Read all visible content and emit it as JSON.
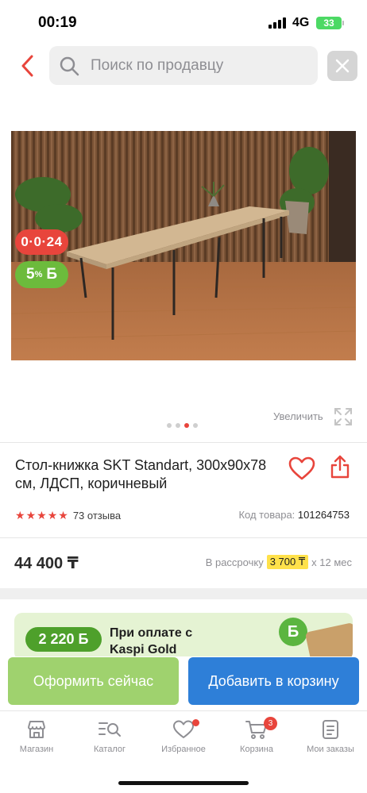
{
  "status_bar": {
    "time": "00:19",
    "network": "4G",
    "battery": "33"
  },
  "search": {
    "placeholder": "Поиск по продавцу"
  },
  "product": {
    "badge_installment": "0·0·24",
    "badge_bonus_percent": "5",
    "badge_bonus_symbol": "%",
    "badge_bonus_currency": "Б",
    "image_dots_total": 4,
    "image_dots_active_index": 2,
    "zoom_label": "Увеличить",
    "title": "Стол-книжка SKT Standart, 300x90x78 см, ЛДСП, коричневый",
    "rating": 5,
    "reviews": "73 отзыва",
    "sku_label": "Код товара:",
    "sku_value": "101264753",
    "price": "44 400 ₸",
    "installment_prefix": "В рассрочку",
    "installment_monthly": "3 700 ₸",
    "installment_suffix": "x 12 мес"
  },
  "promo": {
    "amount": "2 220 Б",
    "text_line1": "При оплате с",
    "text_line2": "Kaspi Gold",
    "logo_letter": "Б"
  },
  "actions": {
    "buy_now": "Оформить сейчас",
    "add_to_cart": "Добавить в корзину"
  },
  "tabs": [
    {
      "label": "Магазин",
      "icon": "shop-icon"
    },
    {
      "label": "Каталог",
      "icon": "catalog-search-icon"
    },
    {
      "label": "Избранное",
      "icon": "heart-icon",
      "dot": true
    },
    {
      "label": "Корзина",
      "icon": "cart-icon",
      "count": "3"
    },
    {
      "label": "Мои заказы",
      "icon": "orders-icon"
    }
  ],
  "colors": {
    "accent_red": "#e8453c",
    "bonus_green": "#6cbb3c",
    "buy_now_green": "#9fd26e",
    "cart_blue": "#2e7fd8",
    "installment_yellow": "#ffe14a"
  }
}
